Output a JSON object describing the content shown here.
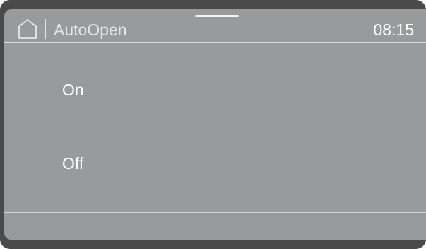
{
  "header": {
    "home_icon": "home-icon",
    "title": "AutoOpen",
    "time": "08:15"
  },
  "options": [
    {
      "label": "On"
    },
    {
      "label": "Off"
    }
  ],
  "colors": {
    "bezel": "#4a4a4a",
    "screen": "#999a9c",
    "text": "#ffffff",
    "divider": "#d9d9d9"
  }
}
